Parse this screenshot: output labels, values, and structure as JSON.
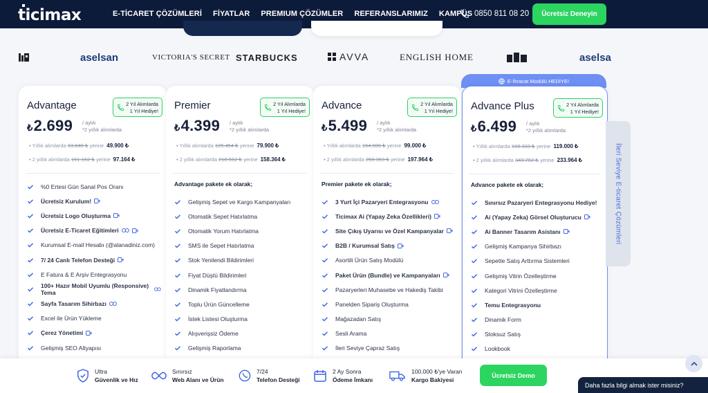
{
  "nav": {
    "logo": "ticimax",
    "menu": [
      "E-TİCARET ÇÖZÜMLERİ",
      "FİYATLAR",
      "PREMIUM ÇÖZÜMLER",
      "REFERANSLARIMIZ",
      "KAMPÜS"
    ],
    "phone": "0850 811 08 20",
    "cta": "Ücretsiz Deneyin"
  },
  "brands": [
    "aselsan",
    "VICTORIA'S SECRET",
    "STARBUCKS",
    "AVVA",
    "ENGLISH HOME",
    "aselsa"
  ],
  "colors": {
    "accent": "#2bd55f",
    "navy": "#0d1b3a",
    "highlight": "#6e8ff4"
  },
  "badge": {
    "line1": "2 Yıl Alımlarda",
    "line2": "1 Yıl Hediye!"
  },
  "price_note": {
    "line1": "/ aylık",
    "line2": "*2 yıllık alımlarda"
  },
  "yearly_label": "Yıllık alımlarda",
  "two_year_label": "2 yıllık alımlarda",
  "instead_label": "yerine",
  "plans": [
    {
      "name": "Advantage",
      "price": "2.699",
      "yearly_old": "63.840 ₺",
      "yearly_new": "49.900 ₺",
      "two_old": "161.162 ₺",
      "two_new": "97.164 ₺",
      "heading": "",
      "features": [
        "%0 Ertesi Gün Sanal Pos Oranı",
        "Ücretsiz Kurulum!",
        "Ücretsiz Logo Oluşturma",
        "Ücretsiz E-Ticaret Eğitimleri",
        "Kurumsal E-mail Hesabı (@alanadiniz.com)",
        "7/ 24 Canlı Telefon Desteği",
        "E Fatura & E Arşiv Entegrasyonu",
        "100+ Hazır Mobil Uyumlu (Responsive) Tema",
        "Sayfa Tasarım Sihirbazı",
        "Excel ile Ürün Yükleme",
        "Çerez Yönetimi",
        "Gelişmiş SEO Altyapısı"
      ]
    },
    {
      "name": "Premier",
      "price": "4.399",
      "yearly_old": "125.454 ₺",
      "yearly_new": "79.900 ₺",
      "two_old": "218.562 ₺",
      "two_new": "158.364 ₺",
      "heading": "Advantage pakete ek olarak;",
      "features": [
        "Gelişmiş Sepet ve Kargo Kampanyaları",
        "Otomatik Sepet Hatırlatma",
        "Otomatik Yorum Hatırlatma",
        "SMS ile Sepet Hatırlatma",
        "Stok Yenilendi Bildirimleri",
        "Fiyat Düştü Bildirimleri",
        "Dinamik Fiyatlandırma",
        "Toplu Ürün Güncelleme",
        "İstek Listesi Oluşturma",
        "Alışverişsiz Ödeme",
        "Gelişmiş Raporlama"
      ]
    },
    {
      "name": "Advance",
      "price": "5.499",
      "yearly_old": "164.900 ₺",
      "yearly_new": "99.000 ₺",
      "two_old": "268.363 ₺",
      "two_new": "197.964 ₺",
      "heading": "Premier pakete ek olarak;",
      "features": [
        "3 Yurt İçi Pazaryeri Entegrasyonu",
        "Ticimax Ai (Yapay Zeka Özellikleri)",
        "Site Çıkış Uyarısı ve Özel Kampanyalar",
        "B2B / Kurumsal Satış",
        "Asortili Ürün Satış Modülü",
        "Paket Ürün (Bundle) ve Kampanyaları",
        "Pazaryerleri Muhasebe ve Hakediş Takibi",
        "Panelden Sipariş Oluşturma",
        "Mağazadan Satış",
        "Sesli Arama",
        "İleri Seviye Çapraz Satış"
      ]
    },
    {
      "name": "Advance Plus",
      "price": "6.499",
      "yearly_old": "198.333 ₺",
      "yearly_new": "119.000 ₺",
      "two_old": "343.762 ₺",
      "two_new": "233.964 ₺",
      "heading": "Advance pakete ek olarak;",
      "features": [
        "Sınırsız Pazaryeri Entegrasyonu Hediye!",
        "Ai (Yapay Zeka) Görsel Oluşturucu",
        "Ai Banner Tasarım Asistanı",
        "Gelişmiş Kampanya Sihirbazı",
        "Sepette Satış Arttırma Sistemleri",
        "Gelişmiş Vitrin Özelleştirme",
        "Kategori Vitrini Özelleştirme",
        "Temu Entegrasyonu",
        "Dinamik Form",
        "Stoksuz Satış",
        "Lookbook"
      ]
    }
  ],
  "highlight_tab": "E-İhracat Modülü HEDİYE!",
  "side_tab": "İleri Seviye E-ticaret Çözümleri",
  "bottom": {
    "items": [
      {
        "l1": "Ultra",
        "l2": "Güvenlik ve Hız"
      },
      {
        "l1": "Sınırsız",
        "l2": "Web Alanı ve Ürün"
      },
      {
        "l1": "7/24",
        "l2": "Telefon Desteği"
      },
      {
        "l1": "2 Ay Sonra",
        "l2": "Ödeme İmkanı"
      },
      {
        "l1": "100.000 ₺'ye Varan",
        "l2": "Kargo Bakiyesi"
      }
    ],
    "demo": "Ücretsiz Demo"
  },
  "chat": "Daha fazla bilgi almak ister misiniz?"
}
